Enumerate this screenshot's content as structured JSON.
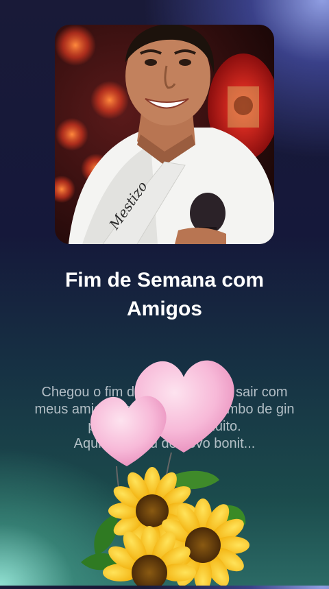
{
  "post": {
    "title": "Fim de Semana com Amigos",
    "description_lines": [
      "Chegou o fim de semana e vou sair com",
      "meus amigos tomar um bom combo de gin",
      "para curtir e beber muito.",
      "Aqui estou eu de novo bonit..."
    ]
  },
  "cover": {
    "sash_text": "Mestizo"
  },
  "sticker": {
    "hearts_color": "#f7b9d8",
    "flower_color": "#f5c518"
  }
}
